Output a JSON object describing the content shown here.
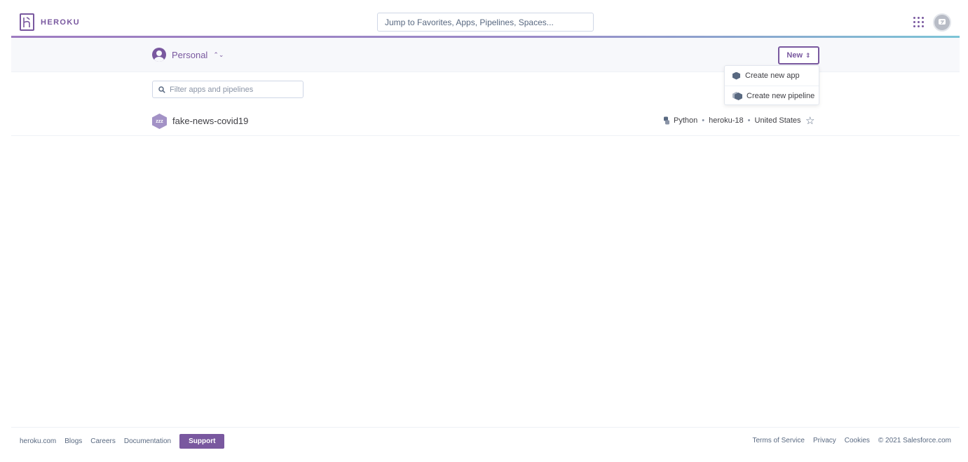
{
  "header": {
    "logo_text": "HEROKU",
    "search_placeholder": "Jump to Favorites, Apps, Pipelines, Spaces..."
  },
  "subbar": {
    "account_label": "Personal",
    "new_button_label": "New"
  },
  "new_menu": {
    "items": [
      {
        "label": "Create new app",
        "icon": "app-hexagon-icon"
      },
      {
        "label": "Create new pipeline",
        "icon": "pipeline-hexagon-icon"
      }
    ]
  },
  "filter": {
    "placeholder": "Filter apps and pipelines"
  },
  "apps": [
    {
      "name": "fake-news-covid19",
      "language": "Python",
      "stack": "heroku-18",
      "region": "United States",
      "icon_text": "zzz"
    }
  ],
  "footer": {
    "left_links": [
      "heroku.com",
      "Blogs",
      "Careers",
      "Documentation"
    ],
    "support_label": "Support",
    "right_links": [
      "Terms of Service",
      "Privacy",
      "Cookies"
    ],
    "copyright": "© 2021 Salesforce.com"
  },
  "colors": {
    "brand": "#79589f",
    "text": "#3f3f44",
    "muted": "#596981"
  }
}
